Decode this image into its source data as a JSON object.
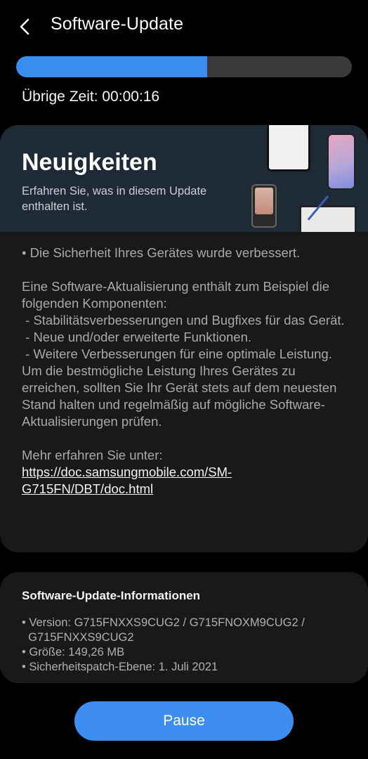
{
  "header": {
    "title": "Software-Update",
    "back_icon": "chevron-left-icon"
  },
  "progress": {
    "fraction": 0.57,
    "remaining_label": "Übrige Zeit: 00:00:16"
  },
  "news": {
    "title": "Neuigkeiten",
    "subtitle": "Erfahren Sie, was in diesem Update enthalten ist.",
    "line1": "• Die Sicherheit Ihres Gerätes wurde verbessert.",
    "paragraph": "Eine Software-Aktualisierung enthält zum Beispiel die folgenden Komponenten:\n - Stabilitätsverbesserungen und Bugfixes für das Gerät.\n - Neue und/oder erweiterte Funktionen.\n - Weitere Verbesserungen für eine optimale Leistung.\nUm die bestmögliche Leistung Ihres Gerätes zu erreichen, sollten Sie Ihr Gerät stets auf dem neuesten Stand halten und regelmäßig auf mögliche Software-Aktualisierungen prüfen.",
    "more_label": "Mehr erfahren Sie unter:",
    "link": "https://doc.samsungmobile.com/SM-G715FN/DBT/doc.html"
  },
  "info": {
    "title": "Software-Update-Informationen",
    "version": "• Version: G715FNXXS9CUG2 / G715FNOXM9CUG2 /\n  G715FNXXS9CUG2",
    "size": "• Größe: 149,26 MB",
    "patch": "• Sicherheitspatch-Ebene: 1. Juli 2021"
  },
  "actions": {
    "pause_label": "Pause"
  },
  "colors": {
    "accent": "#3e91f3",
    "progress_fill": "#3a8ef0",
    "button": "#3e8ef0"
  }
}
